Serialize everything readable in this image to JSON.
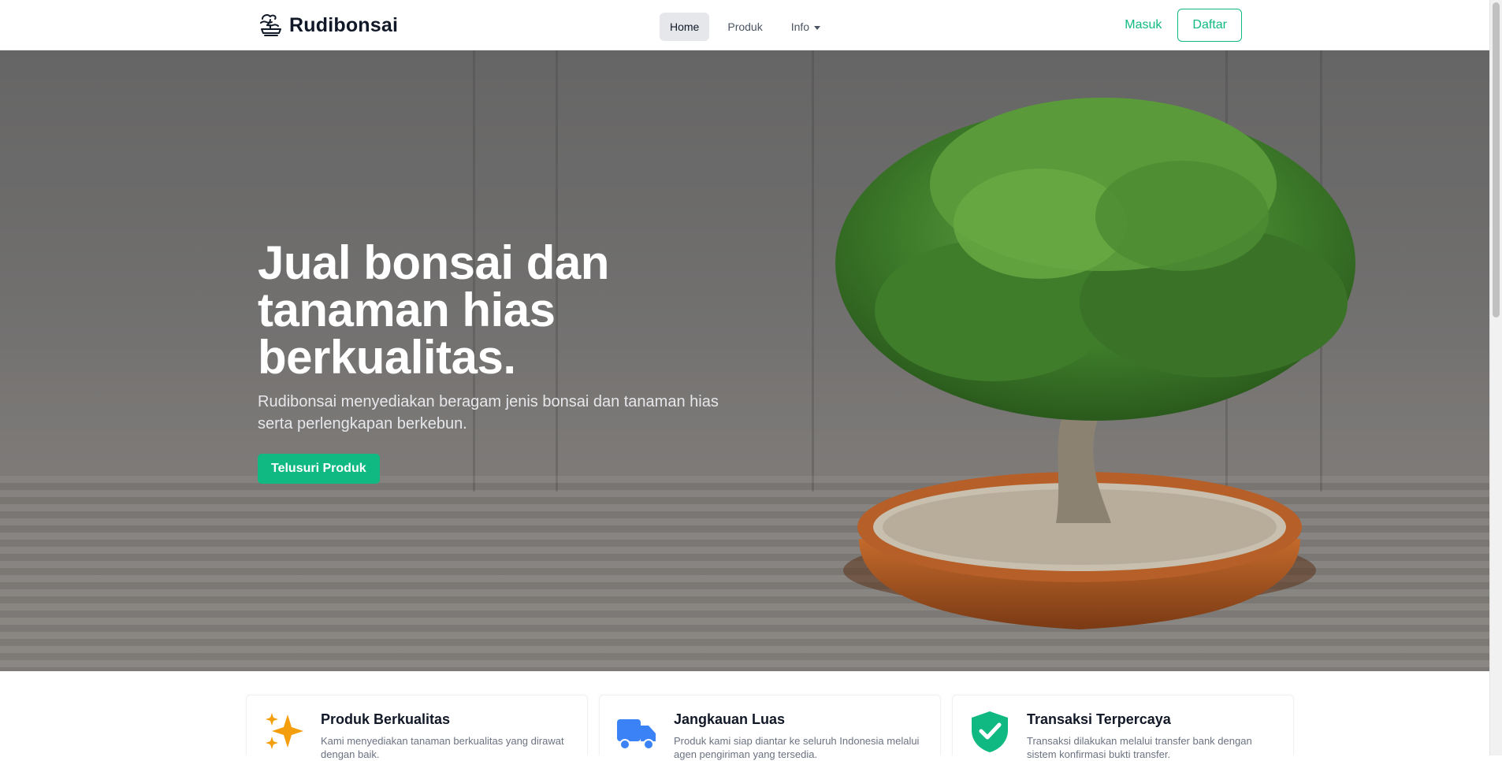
{
  "brand": {
    "name": "Rudibonsai",
    "icon": "bonsai-logo-icon"
  },
  "nav": {
    "items": [
      {
        "label": "Home",
        "active": true
      },
      {
        "label": "Produk",
        "active": false
      },
      {
        "label": "Info",
        "active": false,
        "has_dropdown": true
      }
    ],
    "login_label": "Masuk",
    "register_label": "Daftar"
  },
  "hero": {
    "title": "Jual bonsai dan tanaman hias berkualitas.",
    "subtitle": "Rudibonsai menyediakan beragam jenis bonsai dan tanaman hias serta perlengkapan berkebun.",
    "cta_label": "Telusuri Produk",
    "image": "bonsai-tree-in-pot"
  },
  "features": [
    {
      "icon": "sparkles-icon",
      "icon_color": "#f59e0b",
      "title": "Produk Berkualitas",
      "desc": "Kami menyediakan tanaman berkualitas yang dirawat dengan baik."
    },
    {
      "icon": "truck-icon",
      "icon_color": "#3b82f6",
      "title": "Jangkauan Luas",
      "desc": "Produk kami siap diantar ke seluruh Indonesia melalui agen pengiriman yang tersedia."
    },
    {
      "icon": "shield-check-icon",
      "icon_color": "#10b981",
      "title": "Transaksi Terpercaya",
      "desc": "Transaksi dilakukan melalui transfer bank dengan sistem konfirmasi bukti transfer."
    }
  ],
  "colors": {
    "accent": "#10b981",
    "text_dark": "#111827",
    "text_muted": "#6b7280"
  }
}
